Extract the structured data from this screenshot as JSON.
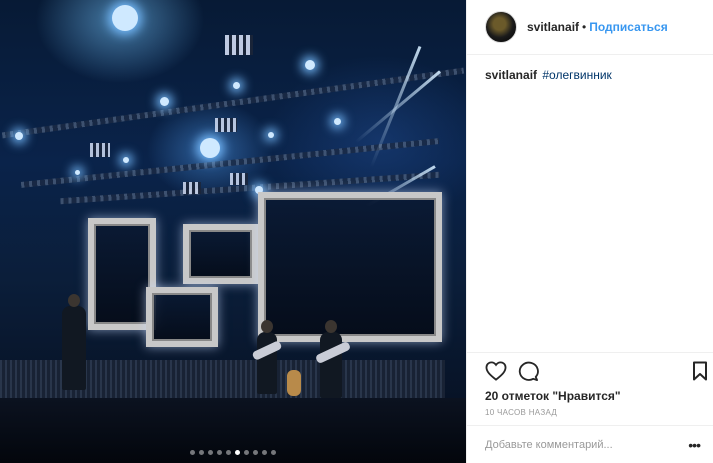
{
  "post": {
    "username": "svitlanaif",
    "follow_label": "Подписаться",
    "separator": "•",
    "caption_user": "svitlanaif",
    "caption_hashtag": "#олегвинник",
    "likes_text": "20 отметок \"Нравится\"",
    "time_text": "10 ЧАСОВ НАЗАД",
    "comment_placeholder": "Добавьте комментарий...",
    "more_label": "•••"
  },
  "carousel": {
    "total_slides": 10,
    "active_index": 5
  },
  "icons": {
    "like": "heart-icon",
    "comment": "comment-icon",
    "save": "bookmark-icon",
    "more": "more-options-icon"
  },
  "colors": {
    "link_blue": "#3897f0",
    "hashtag_blue": "#003569",
    "text": "#262626",
    "muted": "#999999"
  }
}
